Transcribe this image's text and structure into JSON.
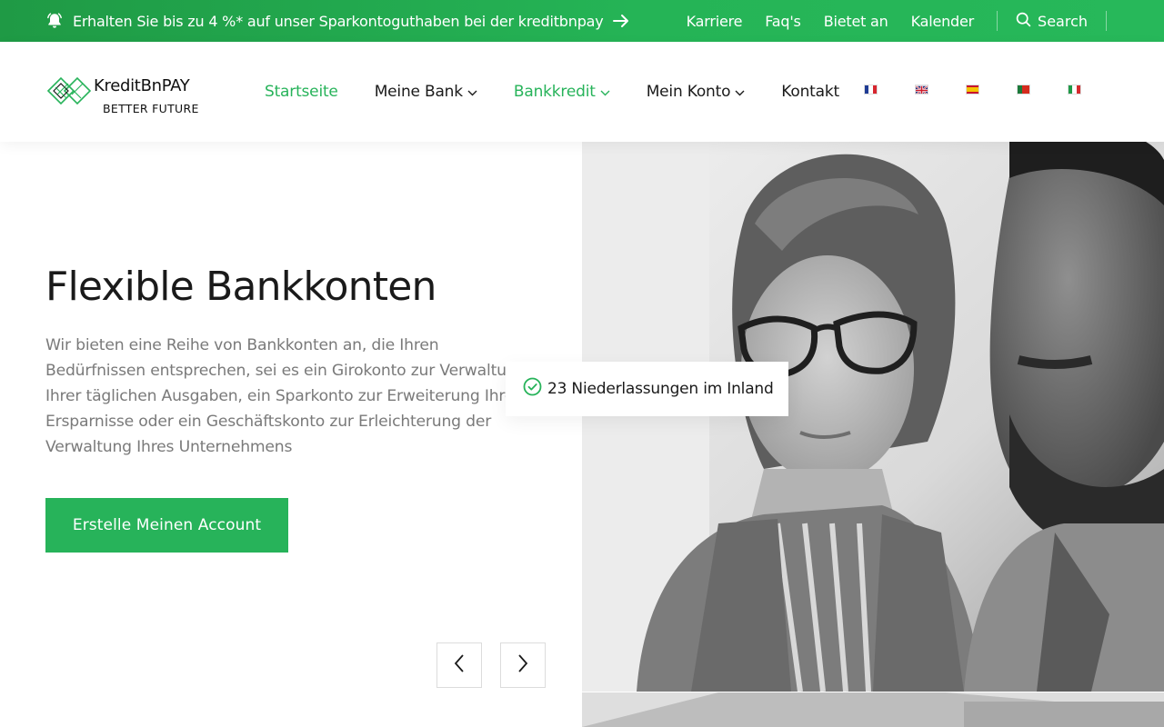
{
  "topbar": {
    "promo_text": "Erhalten Sie bis zu 4 %* auf unser Sparkontoguthaben bei der kreditbnpay",
    "links": [
      "Karriere",
      "Faq's",
      "Bietet an",
      "Kalender"
    ],
    "search_label": "Search"
  },
  "logo": {
    "name": "KreditBnPAY",
    "tagline": "BETTER FUTURE"
  },
  "nav": {
    "items": [
      {
        "label": "Startseite",
        "active": true,
        "dropdown": false
      },
      {
        "label": "Meine Bank",
        "active": false,
        "dropdown": true
      },
      {
        "label": "Bankkredit",
        "active": true,
        "dropdown": true
      },
      {
        "label": "Mein Konto",
        "active": false,
        "dropdown": true
      },
      {
        "label": "Kontakt",
        "active": false,
        "dropdown": false
      }
    ],
    "flags": [
      "flag-fr-icon",
      "flag-gb-icon",
      "flag-es-icon",
      "flag-pt-icon",
      "flag-it-icon"
    ]
  },
  "hero": {
    "title": "Flexible Bankkonten",
    "text": "Wir bieten eine Reihe von Bankkonten an, die Ihren Bedürfnissen entsprechen, sei es ein Girokonto zur Verwaltung Ihrer täglichen Ausgaben, ein Sparkonto zur Erweiterung Ihrer Ersparnisse oder ein Geschäftskonto zur Erleichterung der Verwaltung Ihres Unternehmens",
    "cta_label": "Erstelle Meinen Account",
    "badge_text": "23 Niederlassungen im Inland"
  },
  "colors": {
    "accent": "#27b35a",
    "topbar": "#22a84f",
    "text": "#1a1a1a",
    "muted": "#7a7a7a"
  }
}
